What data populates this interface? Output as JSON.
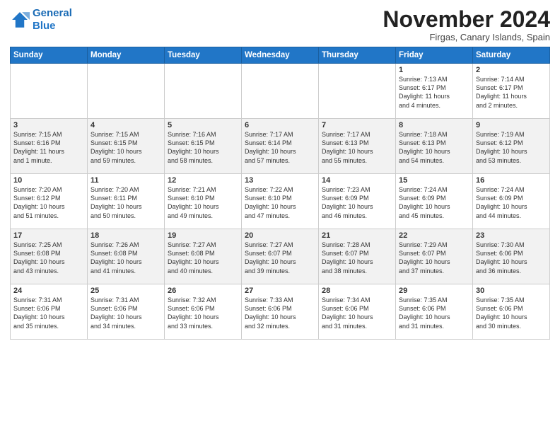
{
  "logo": {
    "line1": "General",
    "line2": "Blue"
  },
  "title": "November 2024",
  "subtitle": "Firgas, Canary Islands, Spain",
  "days_of_week": [
    "Sunday",
    "Monday",
    "Tuesday",
    "Wednesday",
    "Thursday",
    "Friday",
    "Saturday"
  ],
  "weeks": [
    [
      {
        "day": "",
        "info": ""
      },
      {
        "day": "",
        "info": ""
      },
      {
        "day": "",
        "info": ""
      },
      {
        "day": "",
        "info": ""
      },
      {
        "day": "",
        "info": ""
      },
      {
        "day": "1",
        "info": "Sunrise: 7:13 AM\nSunset: 6:17 PM\nDaylight: 11 hours\nand 4 minutes."
      },
      {
        "day": "2",
        "info": "Sunrise: 7:14 AM\nSunset: 6:17 PM\nDaylight: 11 hours\nand 2 minutes."
      }
    ],
    [
      {
        "day": "3",
        "info": "Sunrise: 7:15 AM\nSunset: 6:16 PM\nDaylight: 11 hours\nand 1 minute."
      },
      {
        "day": "4",
        "info": "Sunrise: 7:15 AM\nSunset: 6:15 PM\nDaylight: 10 hours\nand 59 minutes."
      },
      {
        "day": "5",
        "info": "Sunrise: 7:16 AM\nSunset: 6:15 PM\nDaylight: 10 hours\nand 58 minutes."
      },
      {
        "day": "6",
        "info": "Sunrise: 7:17 AM\nSunset: 6:14 PM\nDaylight: 10 hours\nand 57 minutes."
      },
      {
        "day": "7",
        "info": "Sunrise: 7:17 AM\nSunset: 6:13 PM\nDaylight: 10 hours\nand 55 minutes."
      },
      {
        "day": "8",
        "info": "Sunrise: 7:18 AM\nSunset: 6:13 PM\nDaylight: 10 hours\nand 54 minutes."
      },
      {
        "day": "9",
        "info": "Sunrise: 7:19 AM\nSunset: 6:12 PM\nDaylight: 10 hours\nand 53 minutes."
      }
    ],
    [
      {
        "day": "10",
        "info": "Sunrise: 7:20 AM\nSunset: 6:12 PM\nDaylight: 10 hours\nand 51 minutes."
      },
      {
        "day": "11",
        "info": "Sunrise: 7:20 AM\nSunset: 6:11 PM\nDaylight: 10 hours\nand 50 minutes."
      },
      {
        "day": "12",
        "info": "Sunrise: 7:21 AM\nSunset: 6:10 PM\nDaylight: 10 hours\nand 49 minutes."
      },
      {
        "day": "13",
        "info": "Sunrise: 7:22 AM\nSunset: 6:10 PM\nDaylight: 10 hours\nand 47 minutes."
      },
      {
        "day": "14",
        "info": "Sunrise: 7:23 AM\nSunset: 6:09 PM\nDaylight: 10 hours\nand 46 minutes."
      },
      {
        "day": "15",
        "info": "Sunrise: 7:24 AM\nSunset: 6:09 PM\nDaylight: 10 hours\nand 45 minutes."
      },
      {
        "day": "16",
        "info": "Sunrise: 7:24 AM\nSunset: 6:09 PM\nDaylight: 10 hours\nand 44 minutes."
      }
    ],
    [
      {
        "day": "17",
        "info": "Sunrise: 7:25 AM\nSunset: 6:08 PM\nDaylight: 10 hours\nand 43 minutes."
      },
      {
        "day": "18",
        "info": "Sunrise: 7:26 AM\nSunset: 6:08 PM\nDaylight: 10 hours\nand 41 minutes."
      },
      {
        "day": "19",
        "info": "Sunrise: 7:27 AM\nSunset: 6:08 PM\nDaylight: 10 hours\nand 40 minutes."
      },
      {
        "day": "20",
        "info": "Sunrise: 7:27 AM\nSunset: 6:07 PM\nDaylight: 10 hours\nand 39 minutes."
      },
      {
        "day": "21",
        "info": "Sunrise: 7:28 AM\nSunset: 6:07 PM\nDaylight: 10 hours\nand 38 minutes."
      },
      {
        "day": "22",
        "info": "Sunrise: 7:29 AM\nSunset: 6:07 PM\nDaylight: 10 hours\nand 37 minutes."
      },
      {
        "day": "23",
        "info": "Sunrise: 7:30 AM\nSunset: 6:06 PM\nDaylight: 10 hours\nand 36 minutes."
      }
    ],
    [
      {
        "day": "24",
        "info": "Sunrise: 7:31 AM\nSunset: 6:06 PM\nDaylight: 10 hours\nand 35 minutes."
      },
      {
        "day": "25",
        "info": "Sunrise: 7:31 AM\nSunset: 6:06 PM\nDaylight: 10 hours\nand 34 minutes."
      },
      {
        "day": "26",
        "info": "Sunrise: 7:32 AM\nSunset: 6:06 PM\nDaylight: 10 hours\nand 33 minutes."
      },
      {
        "day": "27",
        "info": "Sunrise: 7:33 AM\nSunset: 6:06 PM\nDaylight: 10 hours\nand 32 minutes."
      },
      {
        "day": "28",
        "info": "Sunrise: 7:34 AM\nSunset: 6:06 PM\nDaylight: 10 hours\nand 31 minutes."
      },
      {
        "day": "29",
        "info": "Sunrise: 7:35 AM\nSunset: 6:06 PM\nDaylight: 10 hours\nand 31 minutes."
      },
      {
        "day": "30",
        "info": "Sunrise: 7:35 AM\nSunset: 6:06 PM\nDaylight: 10 hours\nand 30 minutes."
      }
    ]
  ]
}
